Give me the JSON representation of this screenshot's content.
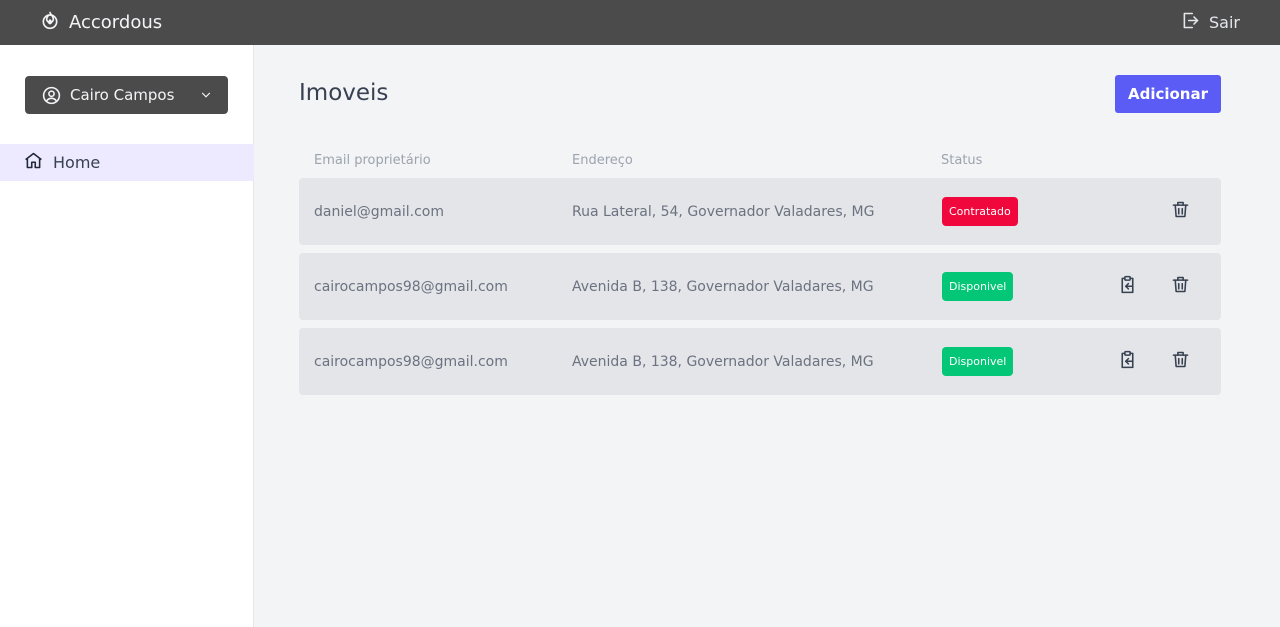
{
  "header": {
    "brand": "Accordous",
    "logout_label": "Sair"
  },
  "sidebar": {
    "user_name": "Cairo Campos",
    "nav_items": [
      {
        "label": "Home",
        "icon": "home-icon"
      }
    ]
  },
  "main": {
    "title": "Imoveis",
    "add_label": "Adicionar",
    "columns": [
      "Email proprietário",
      "Endereço",
      "Status"
    ],
    "rows": [
      {
        "email": "daniel@gmail.com",
        "address": "Rua Lateral, 54, Governador Valadares, MG",
        "status": "Contratado",
        "can_copy": false
      },
      {
        "email": "cairocampos98@gmail.com",
        "address": "Avenida B, 138, Governador Valadares, MG",
        "status": "Disponivel",
        "can_copy": true
      },
      {
        "email": "cairocampos98@gmail.com",
        "address": "Avenida B, 138, Governador Valadares, MG",
        "status": "Disponivel",
        "can_copy": true
      }
    ]
  },
  "colors": {
    "topbar": "#4b4b4c",
    "accent": "#5b5bf6",
    "status_contratado": "#f0073c",
    "status_disponivel": "#03c677",
    "nav_active": "#ede9fe"
  }
}
